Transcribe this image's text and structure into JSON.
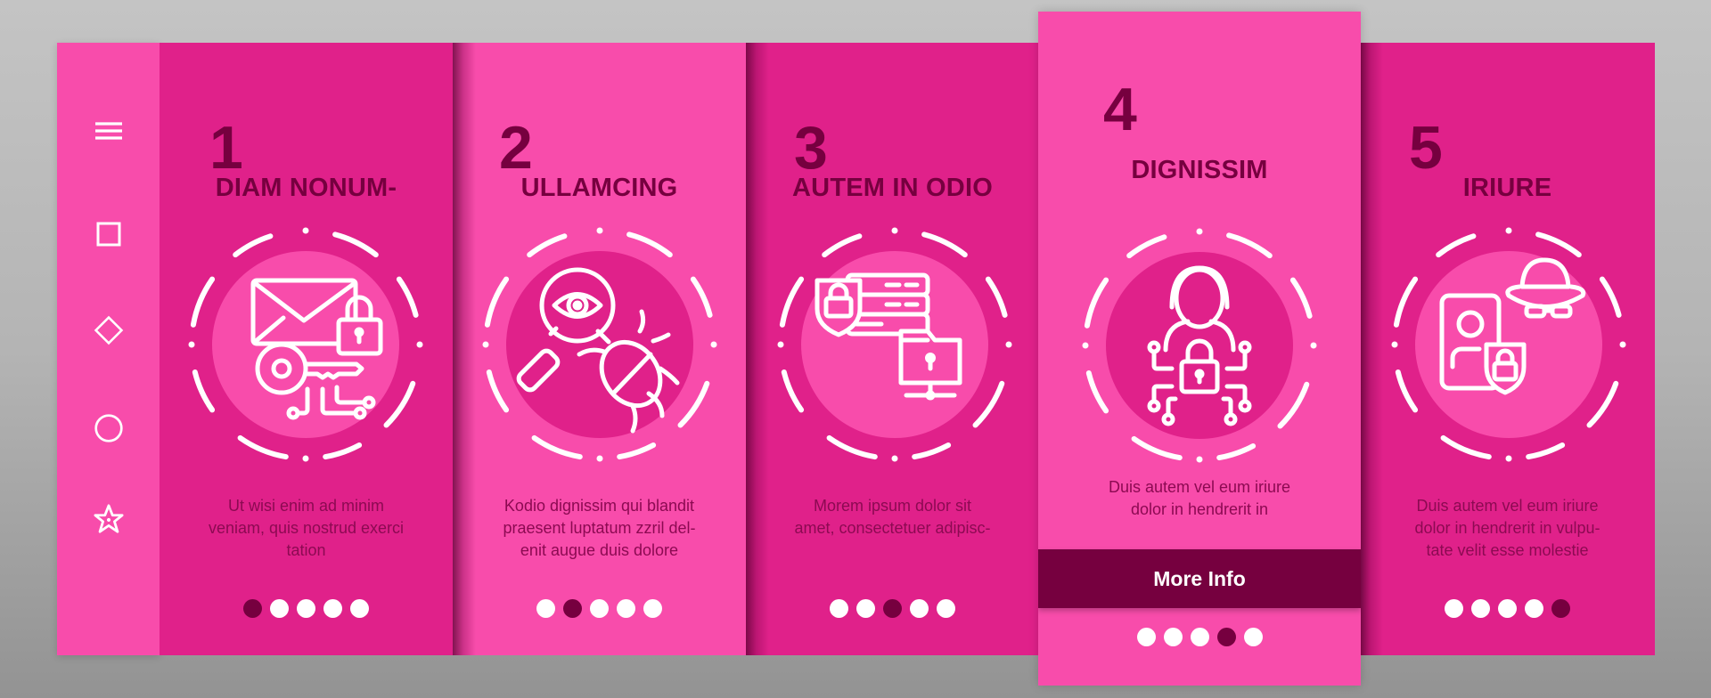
{
  "colors": {
    "background_top": "#c4c4c4",
    "background_bottom": "#939393",
    "panel_dark": "#e0218a",
    "panel_light": "#f84cab",
    "accent_dark": "#76003f",
    "icon_white": "#ffffff"
  },
  "sidebar": {
    "icons": [
      {
        "name": "hamburger-menu-icon"
      },
      {
        "name": "square-icon"
      },
      {
        "name": "diamond-icon"
      },
      {
        "name": "circle-icon"
      },
      {
        "name": "star-icon"
      }
    ]
  },
  "screens": [
    {
      "number": "1",
      "title": "DIAM NONUM-",
      "icon": "email-lock-key-icon",
      "description_lines": [
        "Ut wisi enim ad minim",
        "veniam, quis nostrud exerci",
        "tation"
      ],
      "active_dot": 1,
      "total_dots": 5
    },
    {
      "number": "2",
      "title": "ULLAMCING",
      "icon": "magnifier-eye-bug-icon",
      "description_lines": [
        "Kodio dignissim qui blandit",
        "praesent luptatum zzril del-",
        "enit augue duis dolore"
      ],
      "active_dot": 2,
      "total_dots": 5
    },
    {
      "number": "3",
      "title": "AUTEM IN ODIO",
      "icon": "server-shield-folder-icon",
      "description_lines": [
        "Morem ipsum dolor sit",
        "amet, consectetuer adipisc-"
      ],
      "active_dot": 3,
      "total_dots": 5
    },
    {
      "number": "4",
      "title": "DIGNISSIM",
      "icon": "hacker-lock-circuit-icon",
      "description_lines": [
        "Duis autem vel eum iriure",
        "dolor in hendrerit in"
      ],
      "button_label": "More Info",
      "active_dot": 4,
      "total_dots": 5
    },
    {
      "number": "5",
      "title": "IRIURE",
      "icon": "spy-hat-id-card-shield-icon",
      "description_lines": [
        "Duis autem vel eum iriure",
        "dolor in hendrerit in vulpu-",
        "tate velit esse molestie"
      ],
      "active_dot": 5,
      "total_dots": 5
    }
  ]
}
